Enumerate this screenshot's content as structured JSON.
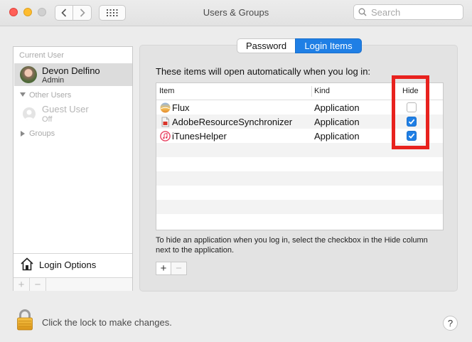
{
  "window": {
    "title": "Users & Groups",
    "search_placeholder": "Search"
  },
  "sidebar": {
    "current_user_header": "Current User",
    "current_user": {
      "name": "Devon Delfino",
      "role": "Admin"
    },
    "other_users_header": "Other Users",
    "guest": {
      "name": "Guest User",
      "status": "Off"
    },
    "groups_label": "Groups",
    "login_options_label": "Login Options",
    "add_symbol": "+",
    "remove_symbol": "−"
  },
  "tabs": {
    "password": "Password",
    "login_items": "Login Items",
    "active": "login_items"
  },
  "login_items": {
    "intro": "These items will open automatically when you log in:",
    "columns": {
      "item": "Item",
      "kind": "Kind",
      "hide": "Hide"
    },
    "rows": [
      {
        "item": "Flux",
        "kind": "Application",
        "hide": false,
        "icon": "flux-icon"
      },
      {
        "item": "AdobeResourceSynchronizer",
        "kind": "Application",
        "hide": true,
        "icon": "adobe-doc-icon"
      },
      {
        "item": "iTunesHelper",
        "kind": "Application",
        "hide": true,
        "icon": "itunes-icon"
      }
    ],
    "hint": "To hide an application when you log in, select the checkbox in the Hide column next to the application.",
    "add_symbol": "+",
    "remove_symbol": "−"
  },
  "footer": {
    "lock_text": "Click the lock to make changes.",
    "help_symbol": "?"
  },
  "colors": {
    "accent": "#1f7fe5",
    "highlight": "#e8221e"
  }
}
